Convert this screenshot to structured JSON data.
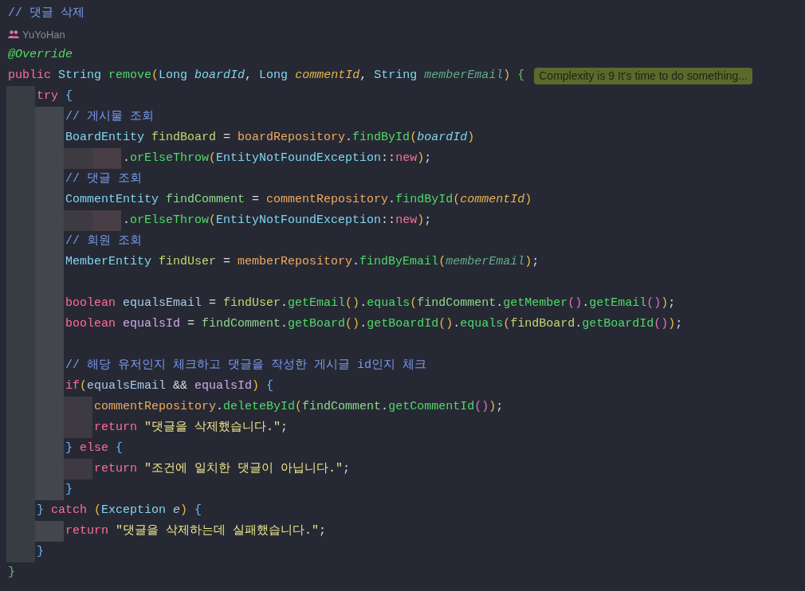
{
  "lines": [
    {
      "kind": "code",
      "tokens": [
        {
          "text": "// 댓글 삭제",
          "kind": "comment"
        }
      ]
    },
    {
      "kind": "author",
      "text": "YuYoHan"
    },
    {
      "kind": "code",
      "tokens": [
        {
          "text": "@Override",
          "kind": "ann"
        }
      ]
    },
    {
      "kind": "code",
      "hint": "Complexity is 9 It's time to do something...",
      "tokens": [
        {
          "text": "public ",
          "kind": "kw"
        },
        {
          "text": "String ",
          "kind": "type"
        },
        {
          "text": "remove",
          "kind": "fn"
        },
        {
          "text": "(",
          "kind": "bracket",
          "color": "#e8b84a"
        },
        {
          "text": "Long ",
          "kind": "type"
        },
        {
          "text": "boardId",
          "kind": "param",
          "color": "#7fd3f0"
        },
        {
          "text": ", ",
          "kind": "punct"
        },
        {
          "text": "Long ",
          "kind": "type"
        },
        {
          "text": "commentId",
          "kind": "param",
          "color": "#e6b450"
        },
        {
          "text": ", ",
          "kind": "punct"
        },
        {
          "text": "String ",
          "kind": "type"
        },
        {
          "text": "memberEmail",
          "kind": "param",
          "color": "#5fae8c"
        },
        {
          "text": ") ",
          "kind": "bracket",
          "color": "#e8b84a"
        },
        {
          "text": "{",
          "kind": "bracket",
          "color": "#5ec46b"
        }
      ]
    },
    {
      "kind": "block",
      "lines": [
        {
          "kind": "code",
          "tokens": [
            {
              "text": "try ",
              "kind": "kw"
            },
            {
              "text": "{",
              "kind": "bracket",
              "color": "#6cb6ff"
            }
          ]
        },
        {
          "kind": "block",
          "lines": [
            {
              "kind": "code",
              "tokens": [
                {
                  "text": "// 게시물 조회",
                  "kind": "comment"
                }
              ]
            },
            {
              "kind": "code",
              "tokens": [
                {
                  "text": "BoardEntity ",
                  "kind": "type"
                },
                {
                  "text": "findBoard",
                  "kind": "var",
                  "color": "#c8d46e"
                },
                {
                  "text": " = ",
                  "kind": "punct"
                },
                {
                  "text": "boardRepository",
                  "kind": "field"
                },
                {
                  "text": ".",
                  "kind": "punct"
                },
                {
                  "text": "findById",
                  "kind": "fn"
                },
                {
                  "text": "(",
                  "kind": "bracket",
                  "color": "#e8b84a"
                },
                {
                  "text": "boardId",
                  "kind": "param",
                  "color": "#7fd3f0"
                },
                {
                  "text": ")",
                  "kind": "bracket",
                  "color": "#e8b84a"
                }
              ]
            },
            {
              "kind": "block",
              "lines": [
                {
                  "kind": "block",
                  "lines": [
                    {
                      "kind": "code",
                      "tokens": [
                        {
                          "text": ".",
                          "kind": "punct"
                        },
                        {
                          "text": "orElseThrow",
                          "kind": "fn"
                        },
                        {
                          "text": "(",
                          "kind": "bracket",
                          "color": "#e8b84a"
                        },
                        {
                          "text": "EntityNotFoundException",
                          "kind": "type"
                        },
                        {
                          "text": "::",
                          "kind": "punct"
                        },
                        {
                          "text": "new",
                          "kind": "kw"
                        },
                        {
                          "text": ")",
                          "kind": "bracket",
                          "color": "#e8b84a"
                        },
                        {
                          "text": ";",
                          "kind": "punct"
                        }
                      ]
                    }
                  ]
                }
              ]
            },
            {
              "kind": "code",
              "tokens": [
                {
                  "text": "// 댓글 조회",
                  "kind": "comment"
                }
              ]
            },
            {
              "kind": "code",
              "tokens": [
                {
                  "text": "CommentEntity ",
                  "kind": "type"
                },
                {
                  "text": "findComment",
                  "kind": "var",
                  "color": "#8fd68c"
                },
                {
                  "text": " = ",
                  "kind": "punct"
                },
                {
                  "text": "commentRepository",
                  "kind": "field"
                },
                {
                  "text": ".",
                  "kind": "punct"
                },
                {
                  "text": "findById",
                  "kind": "fn"
                },
                {
                  "text": "(",
                  "kind": "bracket",
                  "color": "#e8b84a"
                },
                {
                  "text": "commentId",
                  "kind": "param",
                  "color": "#e6b450"
                },
                {
                  "text": ")",
                  "kind": "bracket",
                  "color": "#e8b84a"
                }
              ]
            },
            {
              "kind": "block",
              "lines": [
                {
                  "kind": "block",
                  "lines": [
                    {
                      "kind": "code",
                      "tokens": [
                        {
                          "text": ".",
                          "kind": "punct"
                        },
                        {
                          "text": "orElseThrow",
                          "kind": "fn"
                        },
                        {
                          "text": "(",
                          "kind": "bracket",
                          "color": "#e8b84a"
                        },
                        {
                          "text": "EntityNotFoundException",
                          "kind": "type"
                        },
                        {
                          "text": "::",
                          "kind": "punct"
                        },
                        {
                          "text": "new",
                          "kind": "kw"
                        },
                        {
                          "text": ")",
                          "kind": "bracket",
                          "color": "#e8b84a"
                        },
                        {
                          "text": ";",
                          "kind": "punct"
                        }
                      ]
                    }
                  ]
                }
              ]
            },
            {
              "kind": "code",
              "tokens": [
                {
                  "text": "// 회원 조회",
                  "kind": "comment"
                }
              ]
            },
            {
              "kind": "code",
              "tokens": [
                {
                  "text": "MemberEntity ",
                  "kind": "type"
                },
                {
                  "text": "findUser",
                  "kind": "var",
                  "color": "#c8d46e"
                },
                {
                  "text": " = ",
                  "kind": "punct"
                },
                {
                  "text": "memberRepository",
                  "kind": "field"
                },
                {
                  "text": ".",
                  "kind": "punct"
                },
                {
                  "text": "findByEmail",
                  "kind": "fn"
                },
                {
                  "text": "(",
                  "kind": "bracket",
                  "color": "#e8b84a"
                },
                {
                  "text": "memberEmail",
                  "kind": "param",
                  "color": "#5fae8c"
                },
                {
                  "text": ")",
                  "kind": "bracket",
                  "color": "#e8b84a"
                },
                {
                  "text": ";",
                  "kind": "punct"
                }
              ]
            },
            {
              "kind": "blank"
            },
            {
              "kind": "code",
              "tokens": [
                {
                  "text": "boolean ",
                  "kind": "kw"
                },
                {
                  "text": "equalsEmail",
                  "kind": "var",
                  "color": "#a9c7e8"
                },
                {
                  "text": " = ",
                  "kind": "punct"
                },
                {
                  "text": "findUser",
                  "kind": "var",
                  "color": "#c8d46e"
                },
                {
                  "text": ".",
                  "kind": "punct"
                },
                {
                  "text": "getEmail",
                  "kind": "fn"
                },
                {
                  "text": "()",
                  "kind": "bracket",
                  "color": "#e8b84a"
                },
                {
                  "text": ".",
                  "kind": "punct"
                },
                {
                  "text": "equals",
                  "kind": "fn"
                },
                {
                  "text": "(",
                  "kind": "bracket",
                  "color": "#e8b84a"
                },
                {
                  "text": "findComment",
                  "kind": "var",
                  "color": "#8fd68c"
                },
                {
                  "text": ".",
                  "kind": "punct"
                },
                {
                  "text": "getMember",
                  "kind": "fn"
                },
                {
                  "text": "()",
                  "kind": "bracket",
                  "color": "#e070c0"
                },
                {
                  "text": ".",
                  "kind": "punct"
                },
                {
                  "text": "getEmail",
                  "kind": "fn"
                },
                {
                  "text": "()",
                  "kind": "bracket",
                  "color": "#e070c0"
                },
                {
                  "text": ")",
                  "kind": "bracket",
                  "color": "#e8b84a"
                },
                {
                  "text": ";",
                  "kind": "punct"
                }
              ]
            },
            {
              "kind": "code",
              "tokens": [
                {
                  "text": "boolean ",
                  "kind": "kw"
                },
                {
                  "text": "equalsId",
                  "kind": "var",
                  "color": "#d0a8e8"
                },
                {
                  "text": " = ",
                  "kind": "punct"
                },
                {
                  "text": "findComment",
                  "kind": "var",
                  "color": "#8fd68c"
                },
                {
                  "text": ".",
                  "kind": "punct"
                },
                {
                  "text": "getBoard",
                  "kind": "fn"
                },
                {
                  "text": "()",
                  "kind": "bracket",
                  "color": "#e8b84a"
                },
                {
                  "text": ".",
                  "kind": "punct"
                },
                {
                  "text": "getBoardId",
                  "kind": "fn"
                },
                {
                  "text": "()",
                  "kind": "bracket",
                  "color": "#e8b84a"
                },
                {
                  "text": ".",
                  "kind": "punct"
                },
                {
                  "text": "equals",
                  "kind": "fn"
                },
                {
                  "text": "(",
                  "kind": "bracket",
                  "color": "#e8b84a"
                },
                {
                  "text": "findBoard",
                  "kind": "var",
                  "color": "#c8d46e"
                },
                {
                  "text": ".",
                  "kind": "punct"
                },
                {
                  "text": "getBoardId",
                  "kind": "fn"
                },
                {
                  "text": "()",
                  "kind": "bracket",
                  "color": "#e070c0"
                },
                {
                  "text": ")",
                  "kind": "bracket",
                  "color": "#e8b84a"
                },
                {
                  "text": ";",
                  "kind": "punct"
                }
              ]
            },
            {
              "kind": "blank"
            },
            {
              "kind": "code",
              "tokens": [
                {
                  "text": "// 해당 유저인지 체크하고 댓글을 작성한 게시글 id인지 체크",
                  "kind": "comment"
                }
              ]
            },
            {
              "kind": "code",
              "tokens": [
                {
                  "text": "if",
                  "kind": "kw"
                },
                {
                  "text": "(",
                  "kind": "bracket",
                  "color": "#e8b84a"
                },
                {
                  "text": "equalsEmail",
                  "kind": "var",
                  "color": "#a9c7e8"
                },
                {
                  "text": " && ",
                  "kind": "punct"
                },
                {
                  "text": "equalsId",
                  "kind": "var",
                  "color": "#d0a8e8"
                },
                {
                  "text": ") ",
                  "kind": "bracket",
                  "color": "#e8b84a"
                },
                {
                  "text": "{",
                  "kind": "bracket",
                  "color": "#6cb6ff"
                }
              ]
            },
            {
              "kind": "block",
              "lines": [
                {
                  "kind": "code",
                  "tokens": [
                    {
                      "text": "commentRepository",
                      "kind": "field"
                    },
                    {
                      "text": ".",
                      "kind": "punct"
                    },
                    {
                      "text": "deleteById",
                      "kind": "fn"
                    },
                    {
                      "text": "(",
                      "kind": "bracket",
                      "color": "#e8b84a"
                    },
                    {
                      "text": "findComment",
                      "kind": "var",
                      "color": "#8fd68c"
                    },
                    {
                      "text": ".",
                      "kind": "punct"
                    },
                    {
                      "text": "getCommentId",
                      "kind": "fn"
                    },
                    {
                      "text": "()",
                      "kind": "bracket",
                      "color": "#e070c0"
                    },
                    {
                      "text": ")",
                      "kind": "bracket",
                      "color": "#e8b84a"
                    },
                    {
                      "text": ";",
                      "kind": "punct"
                    }
                  ]
                },
                {
                  "kind": "code",
                  "tokens": [
                    {
                      "text": "return ",
                      "kind": "kw"
                    },
                    {
                      "text": "\"댓글을 삭제했습니다.\"",
                      "kind": "str"
                    },
                    {
                      "text": ";",
                      "kind": "punct"
                    }
                  ]
                }
              ]
            },
            {
              "kind": "code",
              "tokens": [
                {
                  "text": "}",
                  "kind": "bracket",
                  "color": "#6cb6ff"
                },
                {
                  "text": " else ",
                  "kind": "kw"
                },
                {
                  "text": "{",
                  "kind": "bracket",
                  "color": "#6cb6ff"
                }
              ]
            },
            {
              "kind": "block",
              "lines": [
                {
                  "kind": "code",
                  "tokens": [
                    {
                      "text": "return ",
                      "kind": "kw"
                    },
                    {
                      "text": "\"조건에 일치한 댓글이 아닙니다.\"",
                      "kind": "str"
                    },
                    {
                      "text": ";",
                      "kind": "punct"
                    }
                  ]
                }
              ]
            },
            {
              "kind": "code",
              "tokens": [
                {
                  "text": "}",
                  "kind": "bracket",
                  "color": "#6cb6ff"
                }
              ]
            }
          ]
        },
        {
          "kind": "code",
          "tokens": [
            {
              "text": "}",
              "kind": "bracket",
              "color": "#6cb6ff"
            },
            {
              "text": " catch ",
              "kind": "kw"
            },
            {
              "text": "(",
              "kind": "bracket",
              "color": "#e8b84a"
            },
            {
              "text": "Exception ",
              "kind": "type"
            },
            {
              "text": "e",
              "kind": "param",
              "color": "#a9c7e8"
            },
            {
              "text": ") ",
              "kind": "bracket",
              "color": "#e8b84a"
            },
            {
              "text": "{",
              "kind": "bracket",
              "color": "#6cb6ff"
            }
          ]
        },
        {
          "kind": "block",
          "lines": [
            {
              "kind": "code",
              "tokens": [
                {
                  "text": "return ",
                  "kind": "kw"
                },
                {
                  "text": "\"댓글을 삭제하는데 실패했습니다.\"",
                  "kind": "str"
                },
                {
                  "text": ";",
                  "kind": "punct"
                }
              ]
            }
          ]
        },
        {
          "kind": "code",
          "tokens": [
            {
              "text": "}",
              "kind": "bracket",
              "color": "#6cb6ff"
            }
          ]
        }
      ]
    },
    {
      "kind": "code",
      "tokens": [
        {
          "text": "}",
          "kind": "bracket",
          "color": "#5ec46b"
        }
      ]
    }
  ]
}
